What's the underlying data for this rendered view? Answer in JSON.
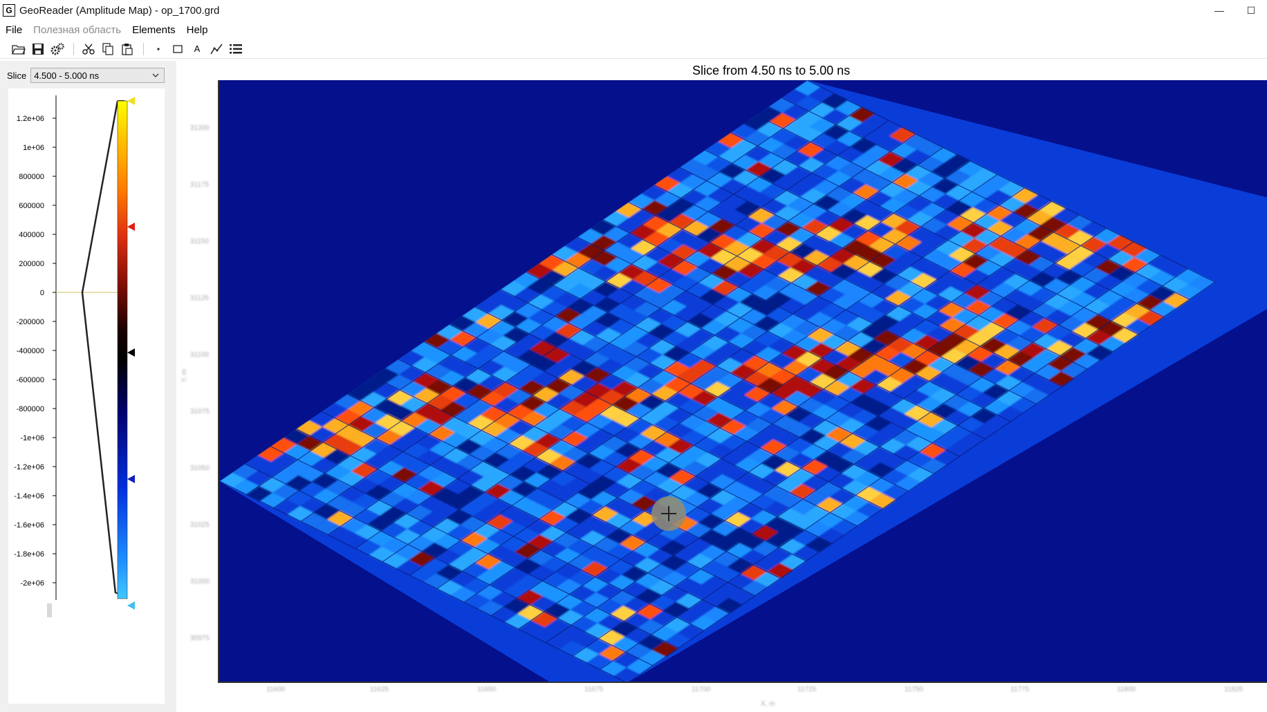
{
  "window": {
    "app_icon_letter": "G",
    "title": "GeoReader (Amplitude Map) - op_1700.grd",
    "minimize_glyph": "—",
    "maximize_glyph": "☐"
  },
  "menu": {
    "items": [
      {
        "label": "File",
        "enabled": true
      },
      {
        "label": "Полезная область",
        "enabled": false
      },
      {
        "label": "Elements",
        "enabled": true
      },
      {
        "label": "Help",
        "enabled": true
      }
    ]
  },
  "toolbar": {
    "icons": [
      "open-folder-icon",
      "save-icon",
      "settings-icon",
      "cut-icon",
      "copy-icon",
      "paste-icon",
      "point-tool-icon",
      "rectangle-tool-icon",
      "text-tool-icon",
      "polyline-tool-icon",
      "list-icon"
    ],
    "text_tool_glyph": "A"
  },
  "slice": {
    "label": "Slice",
    "selected": "4.500 - 5.000 ns"
  },
  "palette": {
    "tick_labels": [
      "1.2e+06",
      "1e+06",
      "800000",
      "600000",
      "400000",
      "200000",
      "0",
      "-200000",
      "-400000",
      "-600000",
      "-800000",
      "-1e+06",
      "-1.2e+06",
      "-1.4e+06",
      "-1.6e+06",
      "-1.8e+06",
      "-2e+06"
    ],
    "marker_colors": {
      "top": "#f0e020",
      "upper": "#e02010",
      "middle": "#000000",
      "lower": "#1020c0",
      "bottom": "#40c0f0"
    }
  },
  "plot": {
    "title": "Slice from 4.50 ns to 5.00 ns",
    "background_color": "#04108c"
  }
}
